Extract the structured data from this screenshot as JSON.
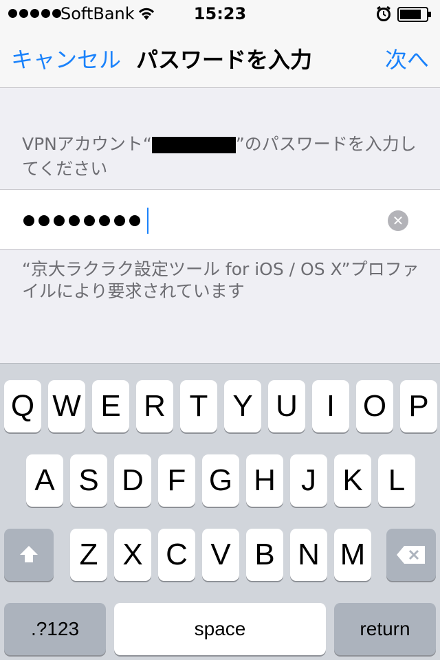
{
  "status_bar": {
    "carrier": "SoftBank",
    "time": "15:23",
    "signal_icon": "signal-dots-icon",
    "wifi_icon": "wifi-icon",
    "alarm_icon": "alarm-icon",
    "battery_icon": "battery-icon"
  },
  "nav": {
    "cancel_label": "キャンセル",
    "title": "パスワードを入力",
    "next_label": "次へ"
  },
  "prompt": {
    "before_redaction": "VPNアカウント“",
    "after_redaction": "”のパスワードを入力してください"
  },
  "password_field": {
    "masked_value": "●●●●●●●●",
    "masked_length": 8,
    "clear_icon": "clear-circle-icon"
  },
  "footer_note": "“京大ラクラク設定ツール for iOS / OS X”プロファイルにより要求されています",
  "keyboard": {
    "row1": [
      "Q",
      "W",
      "E",
      "R",
      "T",
      "Y",
      "U",
      "I",
      "O",
      "P"
    ],
    "row2": [
      "A",
      "S",
      "D",
      "F",
      "G",
      "H",
      "J",
      "K",
      "L"
    ],
    "row3": [
      "Z",
      "X",
      "C",
      "V",
      "B",
      "N",
      "M"
    ],
    "numbers_label": ".?123",
    "space_label": "space",
    "return_label": "return",
    "shift_icon": "shift-arrow-icon",
    "backspace_icon": "backspace-icon"
  },
  "colors": {
    "accent": "#1a82fb",
    "background": "#efeff4",
    "secondary_text": "#6d6d72",
    "keyboard_bg": "#d1d5db"
  }
}
